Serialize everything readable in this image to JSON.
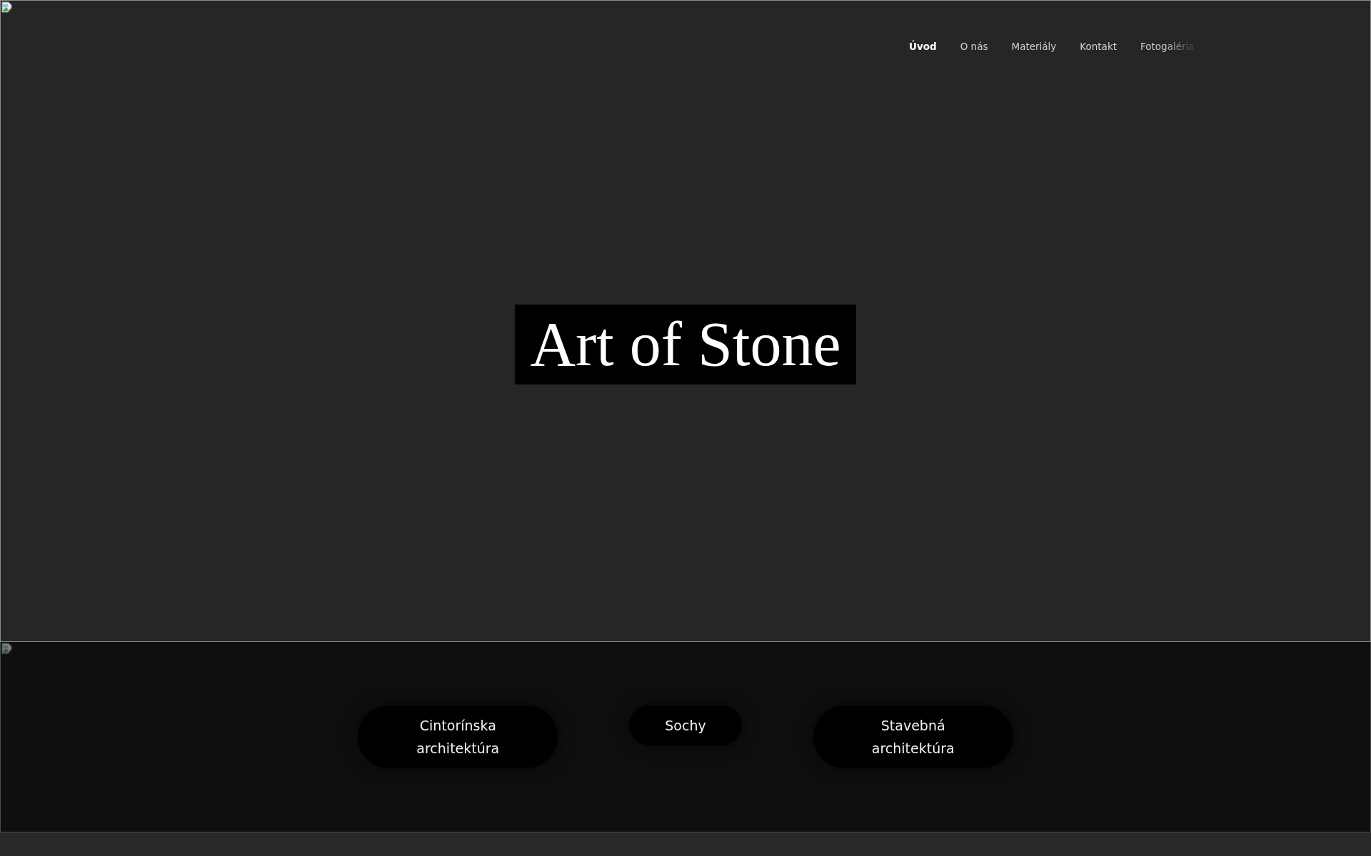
{
  "hero": {
    "nav": [
      {
        "label": "Úvod",
        "selected": true,
        "faded": false
      },
      {
        "label": "O nás",
        "selected": false,
        "faded": false
      },
      {
        "label": "Materiály",
        "selected": false,
        "faded": false
      },
      {
        "label": "Kontakt",
        "selected": false,
        "faded": false
      },
      {
        "label": "Fotogaléria",
        "selected": false,
        "faded": true
      }
    ],
    "title": "Art of Stone"
  },
  "categories": {
    "buttons": [
      "Cintorínska architektúra",
      "Sochy",
      "Stavebná architektúra"
    ]
  }
}
